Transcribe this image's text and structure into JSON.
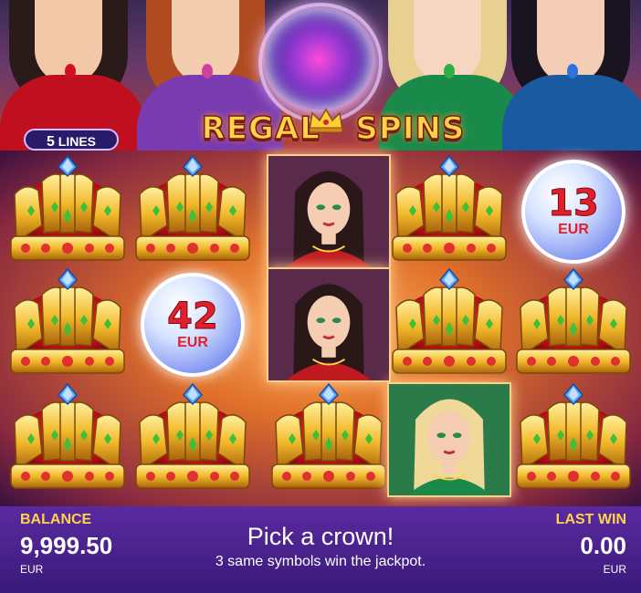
{
  "game": {
    "title_main": "REGAL",
    "title_second": "SPINS",
    "title_number": "5",
    "lines_count": "5",
    "lines_label": "LINES"
  },
  "grid": {
    "rows": [
      [
        "crown",
        "crown",
        "lady-brunette",
        "crown",
        "coin-13"
      ],
      [
        "crown",
        "coin-42",
        "lady-brunette",
        "crown",
        "crown"
      ],
      [
        "crown",
        "crown",
        "crown",
        "lady-blonde",
        "crown"
      ]
    ],
    "coins": {
      "coin-13": {
        "value": "13",
        "currency": "EUR"
      },
      "coin-42": {
        "value": "42",
        "currency": "EUR"
      }
    }
  },
  "footer": {
    "balance_label": "BALANCE",
    "balance_value": "9,999.50",
    "balance_currency": "EUR",
    "message": "Pick a crown!",
    "submessage": "3 same symbols win the jackpot.",
    "lastwin_label": "LAST WIN",
    "lastwin_value": "0.00",
    "lastwin_currency": "EUR"
  },
  "colors": {
    "footer_bg": "#4a2290",
    "label_gold": "#ffd34a",
    "crown_red": "#c0101a",
    "crown_gold": "#f2b92a",
    "gem_green": "#3ac03a",
    "gem_blue": "#4a9aff"
  }
}
